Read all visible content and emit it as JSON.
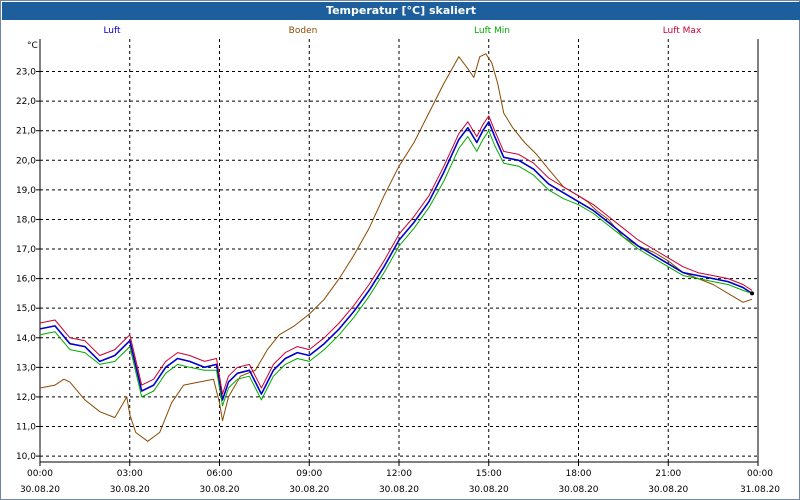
{
  "window": {
    "title": "Temperatur [°C] skaliert"
  },
  "legend": [
    {
      "label": "Luft",
      "color": "#0000cc"
    },
    {
      "label": "Boden",
      "color": "#8b4a00"
    },
    {
      "label": "Luft Min",
      "color": "#00aa00"
    },
    {
      "label": "Luft Max",
      "color": "#cc0033"
    }
  ],
  "chart_data": {
    "type": "line",
    "title": "Temperatur [°C] skaliert",
    "ylabel": "°C",
    "ylim": [
      9.8,
      24.1
    ],
    "xlim": [
      0,
      24
    ],
    "yticks": [
      "10,0",
      "11,0",
      "12,0",
      "13,0",
      "14,0",
      "15,0",
      "16,0",
      "17,0",
      "18,0",
      "19,0",
      "20,0",
      "21,0",
      "22,0",
      "23,0"
    ],
    "xticks": [
      {
        "time": "00:00",
        "date": "30.08.20"
      },
      {
        "time": "03:00",
        "date": "30.08.20"
      },
      {
        "time": "06:00",
        "date": "30.08.20"
      },
      {
        "time": "09:00",
        "date": "30.08.20"
      },
      {
        "time": "12:00",
        "date": "30.08.20"
      },
      {
        "time": "15:00",
        "date": "30.08.20"
      },
      {
        "time": "18:00",
        "date": "30.08.20"
      },
      {
        "time": "21:00",
        "date": "30.08.20"
      },
      {
        "time": "00:00",
        "date": "31.08.20"
      }
    ],
    "grid": true,
    "legend_position": "top",
    "series": [
      {
        "name": "Boden",
        "color": "#8b4a00",
        "x": [
          0,
          0.5,
          0.8,
          1.0,
          1.5,
          2.0,
          2.5,
          2.9,
          3.0,
          3.2,
          3.6,
          4.0,
          4.4,
          4.8,
          5.3,
          5.8,
          6.0,
          6.1,
          6.3,
          6.7,
          7.2,
          7.6,
          8.0,
          8.5,
          9.0,
          9.5,
          10.0,
          10.5,
          11.0,
          11.5,
          12.0,
          12.5,
          13.0,
          13.5,
          14.0,
          14.3,
          14.5,
          14.7,
          14.9,
          15.1,
          15.3,
          15.5,
          15.8,
          16.2,
          16.6,
          17.0,
          17.5,
          18.0,
          18.3,
          18.6,
          19.0,
          19.5,
          20.0,
          20.5,
          21.0,
          21.5,
          22.0,
          22.5,
          23.0,
          23.5,
          23.8
        ],
        "y": [
          12.3,
          12.4,
          12.6,
          12.5,
          11.9,
          11.5,
          11.3,
          12.0,
          11.4,
          10.8,
          10.5,
          10.8,
          11.8,
          12.4,
          12.5,
          12.6,
          11.8,
          11.2,
          12.0,
          12.7,
          12.9,
          13.6,
          14.1,
          14.4,
          14.8,
          15.3,
          16.0,
          16.8,
          17.7,
          18.8,
          19.8,
          20.6,
          21.6,
          22.6,
          23.5,
          23.1,
          22.8,
          23.5,
          23.6,
          23.3,
          22.6,
          21.6,
          21.1,
          20.6,
          20.2,
          19.7,
          19.1,
          18.8,
          18.6,
          18.3,
          18.0,
          17.4,
          17.1,
          16.9,
          16.6,
          16.2,
          16.0,
          15.8,
          15.5,
          15.2,
          15.3
        ]
      },
      {
        "name": "Luft",
        "color": "#0000cc",
        "x": [
          0,
          0.5,
          1.0,
          1.5,
          2.0,
          2.5,
          3.0,
          3.4,
          3.8,
          4.2,
          4.6,
          5.0,
          5.5,
          5.9,
          6.1,
          6.3,
          6.6,
          7.0,
          7.4,
          7.8,
          8.2,
          8.6,
          9.0,
          9.5,
          10.0,
          10.5,
          11.0,
          11.5,
          12.0,
          12.5,
          13.0,
          13.5,
          14.0,
          14.3,
          14.6,
          14.8,
          15.0,
          15.2,
          15.5,
          16.0,
          16.5,
          17.0,
          17.5,
          18.0,
          18.5,
          19.0,
          19.5,
          20.0,
          20.5,
          21.0,
          21.5,
          22.0,
          22.5,
          23.0,
          23.5,
          23.8
        ],
        "y": [
          14.3,
          14.4,
          13.8,
          13.7,
          13.2,
          13.4,
          13.9,
          12.2,
          12.4,
          13.0,
          13.3,
          13.2,
          13.0,
          13.1,
          11.9,
          12.5,
          12.8,
          12.9,
          12.1,
          12.9,
          13.3,
          13.5,
          13.4,
          13.8,
          14.3,
          14.9,
          15.6,
          16.4,
          17.3,
          17.9,
          18.6,
          19.6,
          20.7,
          21.1,
          20.6,
          21.0,
          21.3,
          20.8,
          20.1,
          20.0,
          19.7,
          19.2,
          18.9,
          18.6,
          18.3,
          17.9,
          17.5,
          17.1,
          16.8,
          16.5,
          16.2,
          16.1,
          16.0,
          15.9,
          15.7,
          15.5
        ]
      },
      {
        "name": "Luft Min",
        "color": "#00aa00",
        "x": [
          0,
          0.5,
          1.0,
          1.5,
          2.0,
          2.5,
          3.0,
          3.4,
          3.8,
          4.2,
          4.6,
          5.0,
          5.5,
          5.9,
          6.1,
          6.3,
          6.6,
          7.0,
          7.4,
          7.8,
          8.2,
          8.6,
          9.0,
          9.5,
          10.0,
          10.5,
          11.0,
          11.5,
          12.0,
          12.5,
          13.0,
          13.5,
          14.0,
          14.3,
          14.6,
          14.8,
          15.0,
          15.2,
          15.5,
          16.0,
          16.5,
          17.0,
          17.5,
          18.0,
          18.5,
          19.0,
          19.5,
          20.0,
          20.5,
          21.0,
          21.5,
          22.0,
          22.5,
          23.0,
          23.5,
          23.8
        ],
        "y": [
          14.1,
          14.2,
          13.6,
          13.5,
          13.1,
          13.2,
          13.7,
          12.0,
          12.2,
          12.8,
          13.1,
          13.0,
          12.9,
          12.9,
          11.7,
          12.3,
          12.6,
          12.7,
          11.9,
          12.7,
          13.1,
          13.3,
          13.2,
          13.6,
          14.1,
          14.7,
          15.4,
          16.2,
          17.1,
          17.7,
          18.4,
          19.3,
          20.4,
          20.8,
          20.3,
          20.7,
          21.0,
          20.5,
          19.9,
          19.8,
          19.5,
          19.0,
          18.7,
          18.5,
          18.2,
          17.8,
          17.4,
          17.0,
          16.7,
          16.4,
          16.1,
          16.0,
          15.9,
          15.8,
          15.6,
          15.5
        ]
      },
      {
        "name": "Luft Max",
        "color": "#cc0033",
        "x": [
          0,
          0.5,
          1.0,
          1.5,
          2.0,
          2.5,
          3.0,
          3.4,
          3.8,
          4.2,
          4.6,
          5.0,
          5.5,
          5.9,
          6.1,
          6.3,
          6.6,
          7.0,
          7.4,
          7.8,
          8.2,
          8.6,
          9.0,
          9.5,
          10.0,
          10.5,
          11.0,
          11.5,
          12.0,
          12.5,
          13.0,
          13.5,
          14.0,
          14.3,
          14.6,
          14.8,
          15.0,
          15.2,
          15.5,
          16.0,
          16.5,
          17.0,
          17.5,
          18.0,
          18.5,
          19.0,
          19.5,
          20.0,
          20.5,
          21.0,
          21.5,
          22.0,
          22.5,
          23.0,
          23.5,
          23.8
        ],
        "y": [
          14.5,
          14.6,
          14.0,
          13.9,
          13.4,
          13.6,
          14.1,
          12.4,
          12.6,
          13.2,
          13.5,
          13.4,
          13.2,
          13.3,
          12.1,
          12.7,
          13.0,
          13.1,
          12.3,
          13.1,
          13.5,
          13.7,
          13.6,
          14.0,
          14.5,
          15.1,
          15.8,
          16.6,
          17.5,
          18.1,
          18.8,
          19.8,
          20.9,
          21.3,
          20.8,
          21.2,
          21.5,
          21.0,
          20.3,
          20.2,
          19.9,
          19.4,
          19.1,
          18.8,
          18.5,
          18.1,
          17.7,
          17.3,
          17.0,
          16.7,
          16.4,
          16.2,
          16.1,
          16.0,
          15.8,
          15.6
        ]
      }
    ]
  }
}
